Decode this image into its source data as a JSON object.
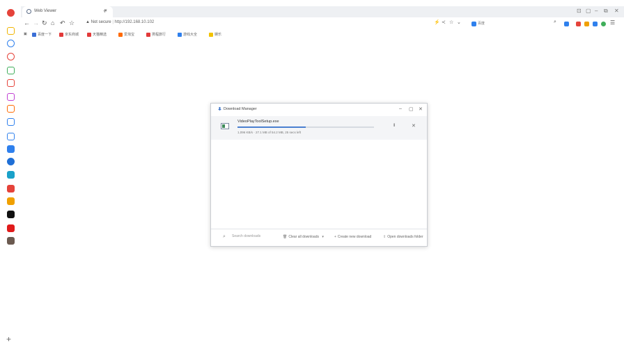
{
  "browser": {
    "tab_title": "Web Viewer",
    "tab_close": "×",
    "new_tab": "+",
    "window_controls": [
      "⊡",
      "▢",
      "–",
      "⧉",
      "✕"
    ],
    "address": {
      "security": "Not secure",
      "separator": "|",
      "url": "http://192.168.10.102"
    },
    "search_label": "百度"
  },
  "bookmarks": [
    {
      "label": "百度一下",
      "color": "#3b6fd6"
    },
    {
      "label": "京东商城",
      "color": "#e23a3a"
    },
    {
      "label": "天猫精选",
      "color": "#e23a3a"
    },
    {
      "label": "爱淘宝",
      "color": "#ff6a00"
    },
    {
      "label": "携程旅行",
      "color": "#e23a3a"
    },
    {
      "label": "游戏大全",
      "color": "#2f80ed"
    },
    {
      "label": "娱乐",
      "color": "#f2c200"
    }
  ],
  "sidebar": {
    "icons": [
      {
        "name": "chrome-icon",
        "color": "#e5433a"
      },
      {
        "name": "star-icon",
        "color": "#f0b400"
      },
      {
        "name": "clock-icon",
        "color": "#2f80ed"
      },
      {
        "name": "record-icon",
        "color": "#e5433a"
      },
      {
        "name": "apps-icon",
        "color": "#3fae5a"
      },
      {
        "name": "image-icon",
        "color": "#e5433a"
      },
      {
        "name": "bag-icon",
        "color": "#c03fd4"
      },
      {
        "name": "gif-icon",
        "color": "#ff6a00"
      },
      {
        "name": "crop-icon",
        "color": "#2f80ed"
      },
      {
        "name": "translate-icon",
        "color": "#2f80ed"
      },
      {
        "name": "notes-icon",
        "color": "#2f80ed"
      },
      {
        "name": "game-icon",
        "color": "#1f6fd6"
      },
      {
        "name": "chat-icon",
        "color": "#1aa1c9"
      },
      {
        "name": "app-red-icon",
        "color": "#e5433a"
      },
      {
        "name": "user-icon",
        "color": "#f0a000"
      },
      {
        "name": "tiktok-icon",
        "color": "#111111"
      },
      {
        "name": "video-icon",
        "color": "#e01b1b"
      },
      {
        "name": "avatar-icon",
        "color": "#6b5a50"
      }
    ],
    "add": "+"
  },
  "download_manager": {
    "title": "Download Manager",
    "controls": [
      "–",
      "▢",
      "✕"
    ],
    "item": {
      "filename": "VideoPlayToolSetup.exe",
      "progress": 0.5,
      "status": "1,096 KB/s · 27.1 MB of 54.2 MB, 25 secs left",
      "pause": "II",
      "close": "✕"
    },
    "footer": {
      "search_placeholder": "Search downloads",
      "clear_all": "Clear all downloads",
      "create_new": "Create new download",
      "open_folder": "Open downloads folder"
    }
  }
}
